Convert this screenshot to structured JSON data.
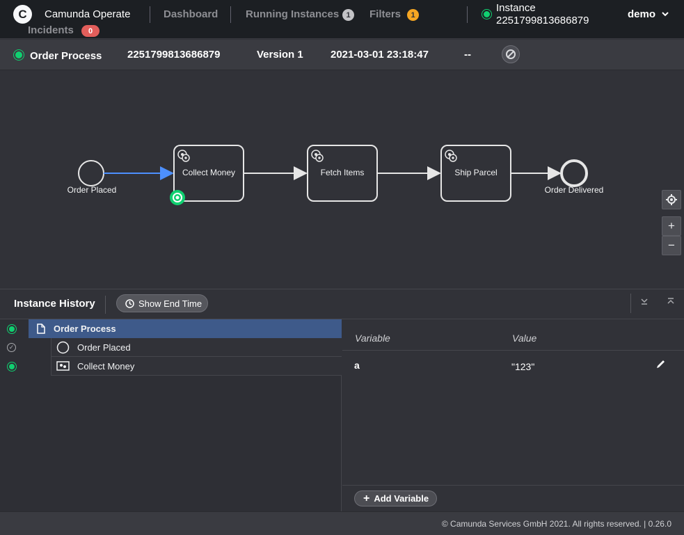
{
  "header": {
    "logo_letter": "C",
    "brand": "Camunda Operate",
    "nav": {
      "dashboard": "Dashboard",
      "running_instances": "Running Instances",
      "running_instances_count": "1",
      "filters": "Filters",
      "filters_count": "1",
      "incidents": "Incidents",
      "incidents_count": "0"
    },
    "instance_label": "Instance",
    "instance_id": "2251799813686879",
    "user": "demo"
  },
  "instance_bar": {
    "process_name": "Order Process",
    "instance_id": "2251799813686879",
    "version": "Version 1",
    "start_date": "2021-03-01 23:18:47",
    "end_date": "--",
    "state_color": "#10d070"
  },
  "diagram": {
    "start_event": "Order Placed",
    "tasks": [
      "Collect Money",
      "Fetch Items",
      "Ship Parcel"
    ],
    "end_event": "Order Delivered",
    "active_flow_color": "#4d90fe",
    "flow_color": "#e6e6e6"
  },
  "history": {
    "title": "Instance History",
    "show_end_time": "Show End Time",
    "rows": [
      {
        "label": "Order Process",
        "state": "active",
        "icon": "document-icon"
      },
      {
        "label": "Order Placed",
        "state": "completed",
        "icon": "start-event-icon"
      },
      {
        "label": "Collect Money",
        "state": "active",
        "icon": "service-task-icon"
      }
    ]
  },
  "variables": {
    "col_variable": "Variable",
    "col_value": "Value",
    "rows": [
      {
        "name": "a",
        "value": "\"123\""
      }
    ],
    "add_variable": "Add Variable"
  },
  "footer": {
    "copyright": "© Camunda Services GmbH 2021. All rights reserved. | 0.26.0"
  }
}
